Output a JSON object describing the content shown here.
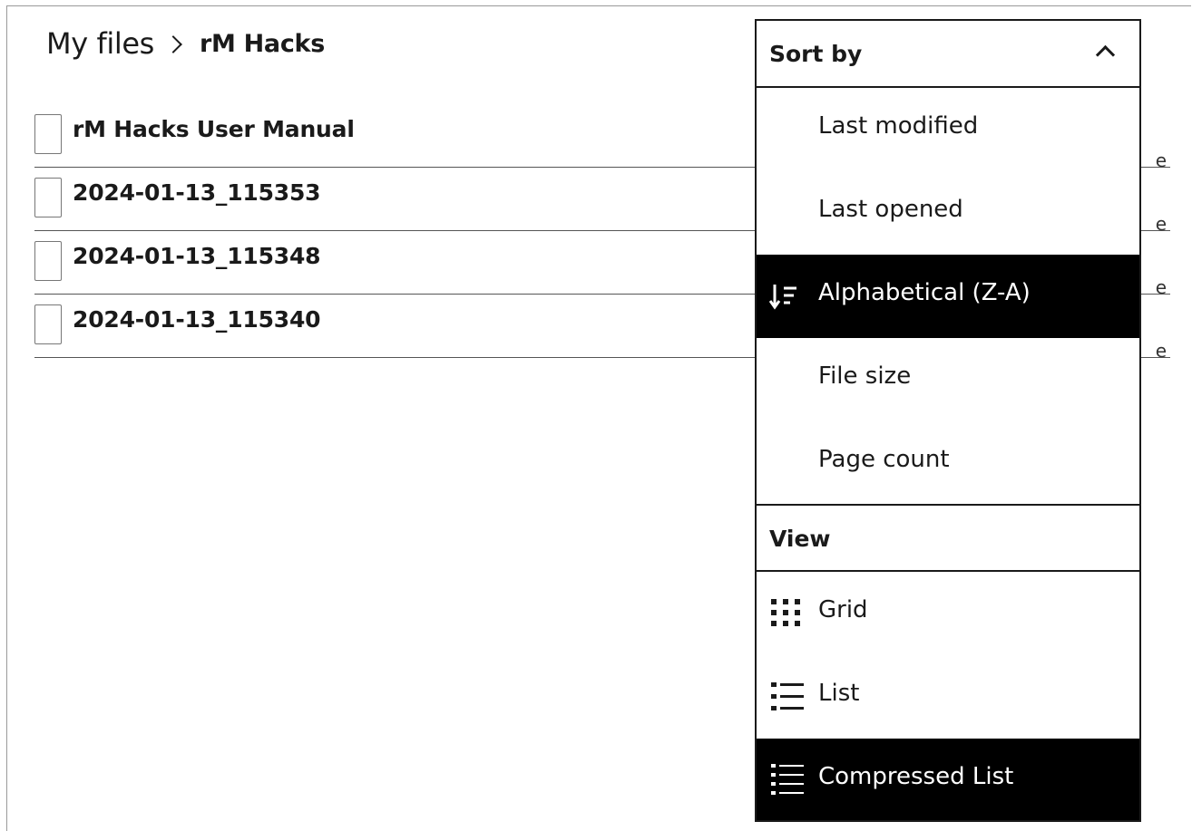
{
  "breadcrumb": {
    "root": "My files",
    "current": "rM Hacks"
  },
  "files": [
    {
      "name": "rM Hacks User Manual"
    },
    {
      "name": "2024-01-13_115353"
    },
    {
      "name": "2024-01-13_115348"
    },
    {
      "name": "2024-01-13_115340"
    }
  ],
  "menu": {
    "sort_header": "Sort by",
    "sort_options": [
      {
        "label": "Last modified"
      },
      {
        "label": "Last opened"
      },
      {
        "label": "Alphabetical (Z-A)",
        "selected": true,
        "icon": "sort-descending-icon"
      },
      {
        "label": "File size"
      },
      {
        "label": "Page count"
      }
    ],
    "view_header": "View",
    "view_options": [
      {
        "label": "Grid",
        "icon": "grid-icon"
      },
      {
        "label": "List",
        "icon": "list-icon"
      },
      {
        "label": "Compressed List",
        "icon": "compressed-list-icon",
        "selected": true
      }
    ]
  },
  "colors": {
    "selected_bg": "#000000",
    "selected_fg": "#ffffff",
    "text": "#1a1a1a"
  }
}
